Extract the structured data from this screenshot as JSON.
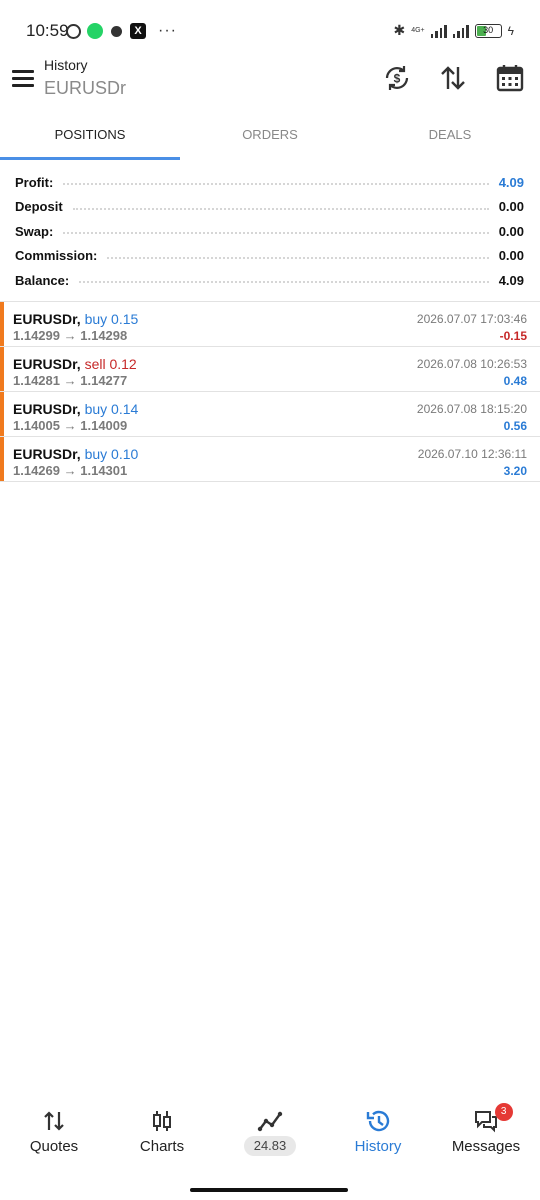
{
  "status_bar": {
    "time": "10:59",
    "more": "···",
    "network": "4G+",
    "battery": "30",
    "x_glyph": "X"
  },
  "header": {
    "title": "History",
    "subtitle": "EURUSDr"
  },
  "tabs": [
    {
      "label": "POSITIONS",
      "active": true
    },
    {
      "label": "ORDERS",
      "active": false
    },
    {
      "label": "DEALS",
      "active": false
    }
  ],
  "summary": [
    {
      "label": "Profit:",
      "value": "4.09",
      "highlight": true
    },
    {
      "label": "Deposit",
      "value": "0.00"
    },
    {
      "label": "Swap:",
      "value": "0.00"
    },
    {
      "label": "Commission:",
      "value": "0.00"
    },
    {
      "label": "Balance:",
      "value": "4.09"
    }
  ],
  "trades": [
    {
      "symbol": "EURUSDr,",
      "direction": "buy 0.15",
      "side": "buy",
      "open_price": "1.14299",
      "arrow": "→",
      "close_price": "1.14298",
      "time": "2026.07.07 17:03:46",
      "profit": "-0.15"
    },
    {
      "symbol": "EURUSDr,",
      "direction": "sell 0.12",
      "side": "sell",
      "open_price": "1.14281",
      "arrow": "→",
      "close_price": "1.14277",
      "time": "2026.07.08 10:26:53",
      "profit": "0.48"
    },
    {
      "symbol": "EURUSDr,",
      "direction": "buy 0.14",
      "side": "buy",
      "open_price": "1.14005",
      "arrow": "→",
      "close_price": "1.14009",
      "time": "2026.07.08 18:15:20",
      "profit": "0.56"
    },
    {
      "symbol": "EURUSDr,",
      "direction": "buy 0.10",
      "side": "buy",
      "open_price": "1.14269",
      "arrow": "→",
      "close_price": "1.14301",
      "time": "2026.07.10 12:36:11",
      "profit": "3.20"
    }
  ],
  "bottom_nav": {
    "quotes": "Quotes",
    "charts": "Charts",
    "trade_value": "24.83",
    "history": "History",
    "messages": "Messages",
    "messages_badge": "3"
  },
  "colors": {
    "accent_blue": "#2a7bd5",
    "loss_red": "#c62828",
    "trade_marker_orange": "#f07a1e"
  },
  "icons": {
    "menu": "menu-icon",
    "account_switch": "dollar-refresh-icon",
    "sort": "sort-arrows-icon",
    "calendar": "calendar-icon",
    "quotes": "quotes-arrows-icon",
    "charts": "candlestick-icon",
    "trade": "trend-line-icon",
    "history": "history-clock-icon",
    "messages": "chat-bubbles-icon"
  }
}
